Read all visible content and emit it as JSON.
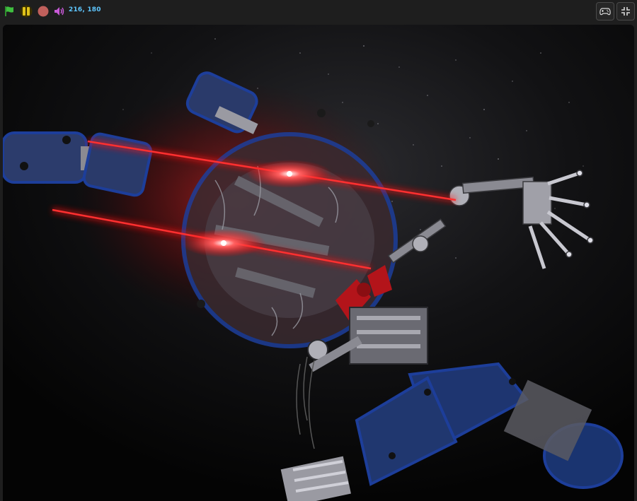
{
  "toolbar": {
    "coordinates": "216, 180",
    "buttons": {
      "green_flag": "green-flag-icon",
      "pause": "pause-icon",
      "stop": "stop-icon",
      "sound": "speaker-icon",
      "controller": "gamepad-icon",
      "fullscreen": "exit-fullscreen-icon"
    }
  },
  "colors": {
    "flag": "#3fbf3f",
    "pause": "#e0c21a",
    "stop": "#c0605c",
    "sound": "#c95ad8",
    "coords": "#5fc7ff",
    "robot_blue": "#1a3a8a",
    "laser_red": "#ff1a1a",
    "metal_gray": "#8a8a8a"
  }
}
